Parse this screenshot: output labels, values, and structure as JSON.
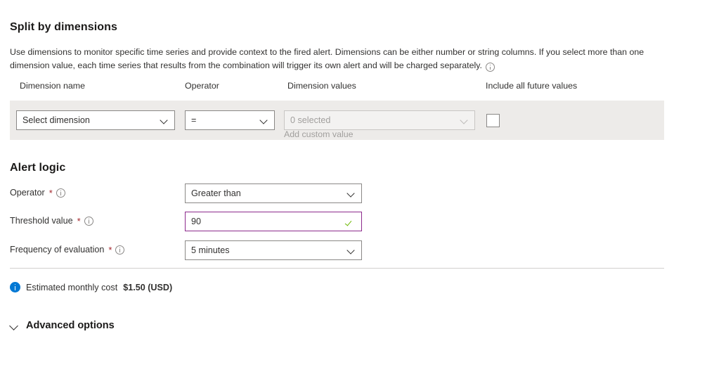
{
  "split_by_dimensions": {
    "title": "Split by dimensions",
    "description": "Use dimensions to monitor specific time series and provide context to the fired alert. Dimensions can be either number or string columns. If you select more than one dimension value, each time series that results from the combination will trigger its own alert and will be charged separately.",
    "description_info_icon": "info-icon",
    "columns": [
      "Dimension name",
      "Operator",
      "Dimension values",
      "Include all future values"
    ],
    "row": {
      "dimension_name": {
        "value": "Select dimension",
        "icon": "chevron-down-icon",
        "disabled": false
      },
      "operator": {
        "value": "=",
        "icon": "chevron-down-icon",
        "disabled": false
      },
      "dimension_values": {
        "value": "0 selected",
        "icon": "chevron-down-icon",
        "disabled": true,
        "helper_text": "Add custom value"
      },
      "include_all_future_values": {
        "checked": false
      }
    }
  },
  "alert_logic": {
    "title": "Alert logic",
    "fields": {
      "operator": {
        "label": "Operator",
        "required_marker": "*",
        "info_icon": "info-icon",
        "value": "Greater than",
        "icon": "chevron-down-icon"
      },
      "threshold_value": {
        "label": "Threshold value",
        "required_marker": "*",
        "info_icon": "info-icon",
        "value": "90",
        "validation_icon": "checkmark-icon",
        "border_color": "#8c2a8c",
        "validation_color": "#6bb700"
      },
      "frequency_of_evaluation": {
        "label": "Frequency of evaluation",
        "required_marker": "*",
        "info_icon": "info-icon",
        "value": "5 minutes",
        "icon": "chevron-down-icon"
      }
    }
  },
  "cost": {
    "info_icon": "info-filled-icon",
    "label": "Estimated monthly cost",
    "amount": "$1.50 (USD)",
    "accent_color": "#0078d4"
  },
  "advanced_options": {
    "label": "Advanced options",
    "icon": "chevron-down-icon",
    "expanded": false
  }
}
